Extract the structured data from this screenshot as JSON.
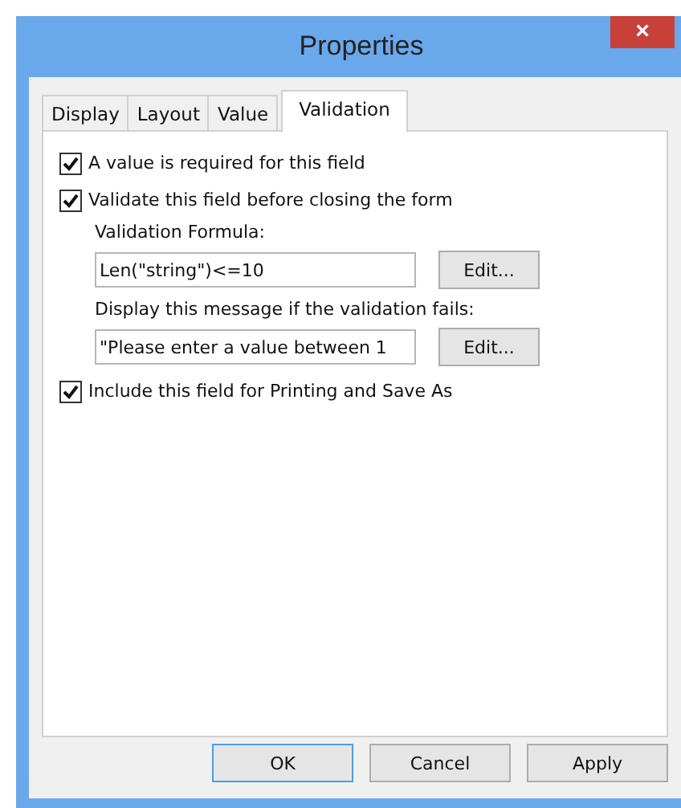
{
  "window": {
    "title": "Properties",
    "close": "×"
  },
  "tabs": [
    {
      "label": "Display",
      "selected": false
    },
    {
      "label": "Layout",
      "selected": false
    },
    {
      "label": "Value",
      "selected": false
    },
    {
      "label": "Validation",
      "selected": true
    }
  ],
  "options": [
    {
      "kind": "checkbox",
      "label": "A value is required for this field",
      "checked": true
    },
    {
      "kind": "checkbox",
      "label": "Validate this field before closing the form",
      "checked": true
    },
    {
      "kind": "field",
      "label": "Validation Formula:",
      "value": "Len(\"string\")<=10",
      "button": "Edit..."
    },
    {
      "kind": "field",
      "label": "Display this message if the validation fails:",
      "value": "\"Please enter a value between 1",
      "button": "Edit..."
    },
    {
      "kind": "checkbox",
      "label": "Include this field for Printing and Save As",
      "checked": true
    }
  ],
  "buttons": [
    {
      "label": "OK",
      "default": true
    },
    {
      "label": "Cancel",
      "default": false
    },
    {
      "label": "Apply",
      "default": false
    }
  ]
}
